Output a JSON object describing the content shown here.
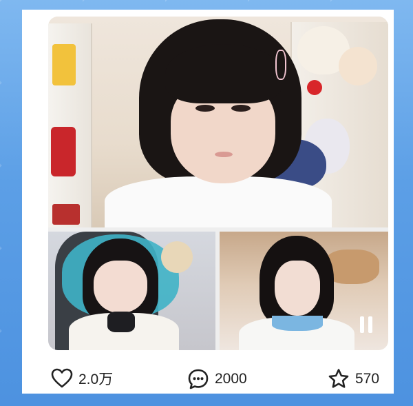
{
  "post": {
    "media": {
      "type": "image-collage",
      "panels": [
        "main-streamer",
        "bottom-left-streamer",
        "bottom-right-streamer"
      ],
      "overlay_icon": "pause-icon"
    },
    "actions": {
      "like": {
        "icon": "heart-icon",
        "count": "2.0万"
      },
      "comment": {
        "icon": "comment-icon",
        "count": "2000"
      },
      "favorite": {
        "icon": "star-icon",
        "count": "570"
      }
    }
  },
  "colors": {
    "background": "#5c9fe6",
    "card": "#ffffff",
    "text": "#222222",
    "pause_overlay": "#ffffff"
  }
}
